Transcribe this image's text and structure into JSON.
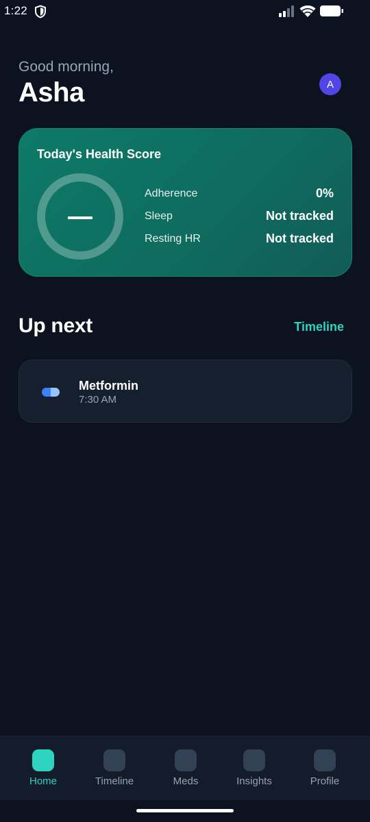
{
  "status_bar": {
    "time": "1:22",
    "icons": [
      "shield-icon",
      "signal-icon",
      "wifi-icon",
      "battery-icon"
    ]
  },
  "header": {
    "greeting": "Good morning,",
    "name": "Asha",
    "avatar_initial": "A",
    "avatar_color": "#4f46e5"
  },
  "health_card": {
    "title": "Today's Health Score",
    "score_display": "—",
    "metrics": [
      {
        "label": "Adherence",
        "value": "0%"
      },
      {
        "label": "Sleep",
        "value": "Not tracked"
      },
      {
        "label": "Resting HR",
        "value": "Not tracked"
      }
    ],
    "colors": {
      "start": "#0d7a68",
      "end": "#125b57"
    }
  },
  "up_next": {
    "title": "Up next",
    "link_label": "Timeline",
    "items": [
      {
        "name": "Metformin",
        "time": "7:30 AM",
        "icon": "pill-icon"
      }
    ]
  },
  "bottom_nav": {
    "items": [
      {
        "label": "Home",
        "active": true
      },
      {
        "label": "Timeline",
        "active": false
      },
      {
        "label": "Meds",
        "active": false
      },
      {
        "label": "Insights",
        "active": false
      },
      {
        "label": "Profile",
        "active": false
      }
    ],
    "accent": "#2dd4bf"
  },
  "theme": {
    "background": "#0c1220",
    "accent": "#2dd4bf"
  }
}
